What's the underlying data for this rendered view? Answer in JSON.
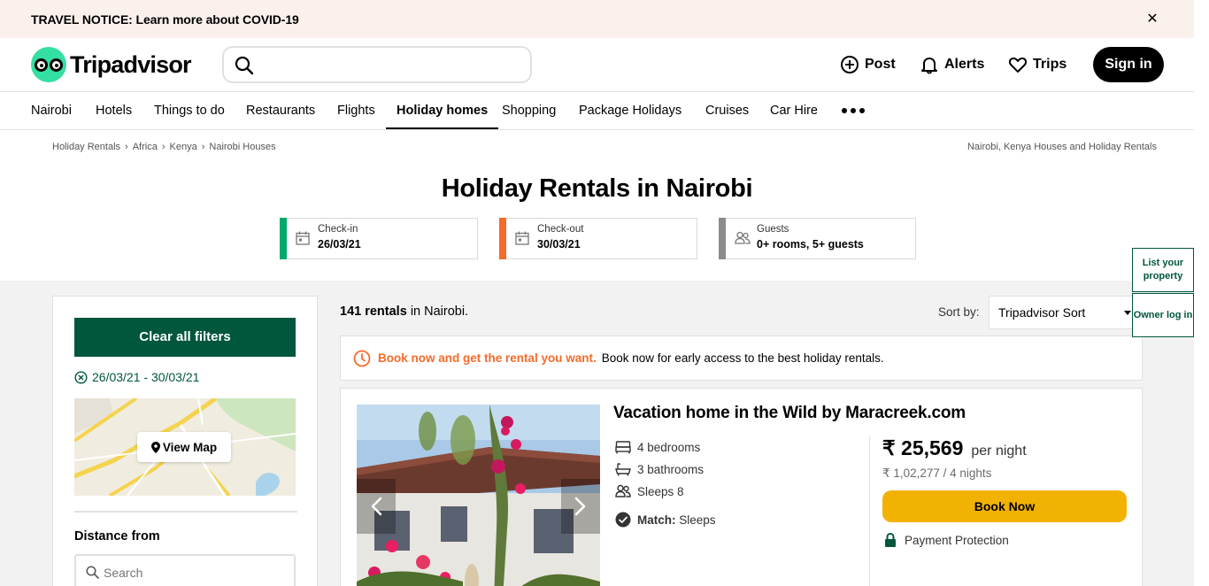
{
  "notice": {
    "text": "TRAVEL NOTICE: Learn more about COVID-19",
    "close_icon": "close-icon"
  },
  "header": {
    "logo_text": "Tripadvisor",
    "search_placeholder": "",
    "search_value": "",
    "nav": {
      "post": "Post",
      "alerts": "Alerts",
      "trips": "Trips",
      "sign_in": "Sign in"
    }
  },
  "categories": [
    {
      "label": "Nairobi"
    },
    {
      "label": "Hotels"
    },
    {
      "label": "Things to do"
    },
    {
      "label": "Restaurants"
    },
    {
      "label": "Flights"
    },
    {
      "label": "Holiday homes"
    },
    {
      "label": "Shopping"
    },
    {
      "label": "Package Holidays"
    },
    {
      "label": "Cruises"
    },
    {
      "label": "Car Hire"
    }
  ],
  "active_category": "Holiday homes",
  "breadcrumb": [
    "Holiday Rentals",
    "Africa",
    "Kenya",
    "Nairobi Houses"
  ],
  "breadcrumb_right": "Nairobi, Kenya Houses and Holiday Rentals",
  "page_title": "Holiday Rentals in Nairobi",
  "pickers": {
    "checkin": {
      "label": "Check-in",
      "value": "26/03/21",
      "color": "#00aa6c"
    },
    "checkout": {
      "label": "Check-out",
      "value": "30/03/21",
      "color": "#f56b2a"
    },
    "guests": {
      "label": "Guests",
      "value": "0+ rooms, 5+ guests",
      "color": "#8c8c8c"
    }
  },
  "sidebar": {
    "clear_label": "Clear all filters",
    "date_range": "26/03/21 - 30/03/21",
    "view_map": "View Map",
    "distance_title": "Distance from",
    "distance_placeholder": "Search"
  },
  "results": {
    "count": "141 rentals",
    "location": "in Nairobi.",
    "sort_label": "Sort by:",
    "sort_value": "Tripadvisor Sort"
  },
  "promo": {
    "highlight": "Book now and get the rental you want.",
    "text": "Book now for early access to the best holiday rentals."
  },
  "listing": {
    "title": "Vacation home in the Wild by Maracreek.com",
    "bedrooms": "4 bedrooms",
    "bathrooms": "3 bathrooms",
    "sleeps": "Sleeps 8",
    "match_label": "Match:",
    "match_value": "Sleeps",
    "price": "₹ 25,569",
    "per_night": "per night",
    "total": "₹ 1,02,277 / 4 nights",
    "book_label": "Book Now",
    "protection": "Payment Protection"
  },
  "side_buttons": {
    "list_property": "List your property",
    "owner_login": "Owner log in"
  },
  "colors": {
    "brand_green": "#34e0a1",
    "dark_green": "#00573d",
    "book_yellow": "#f2b203",
    "promo_orange": "#f56b2a",
    "notice_bg": "#faf1ed"
  }
}
